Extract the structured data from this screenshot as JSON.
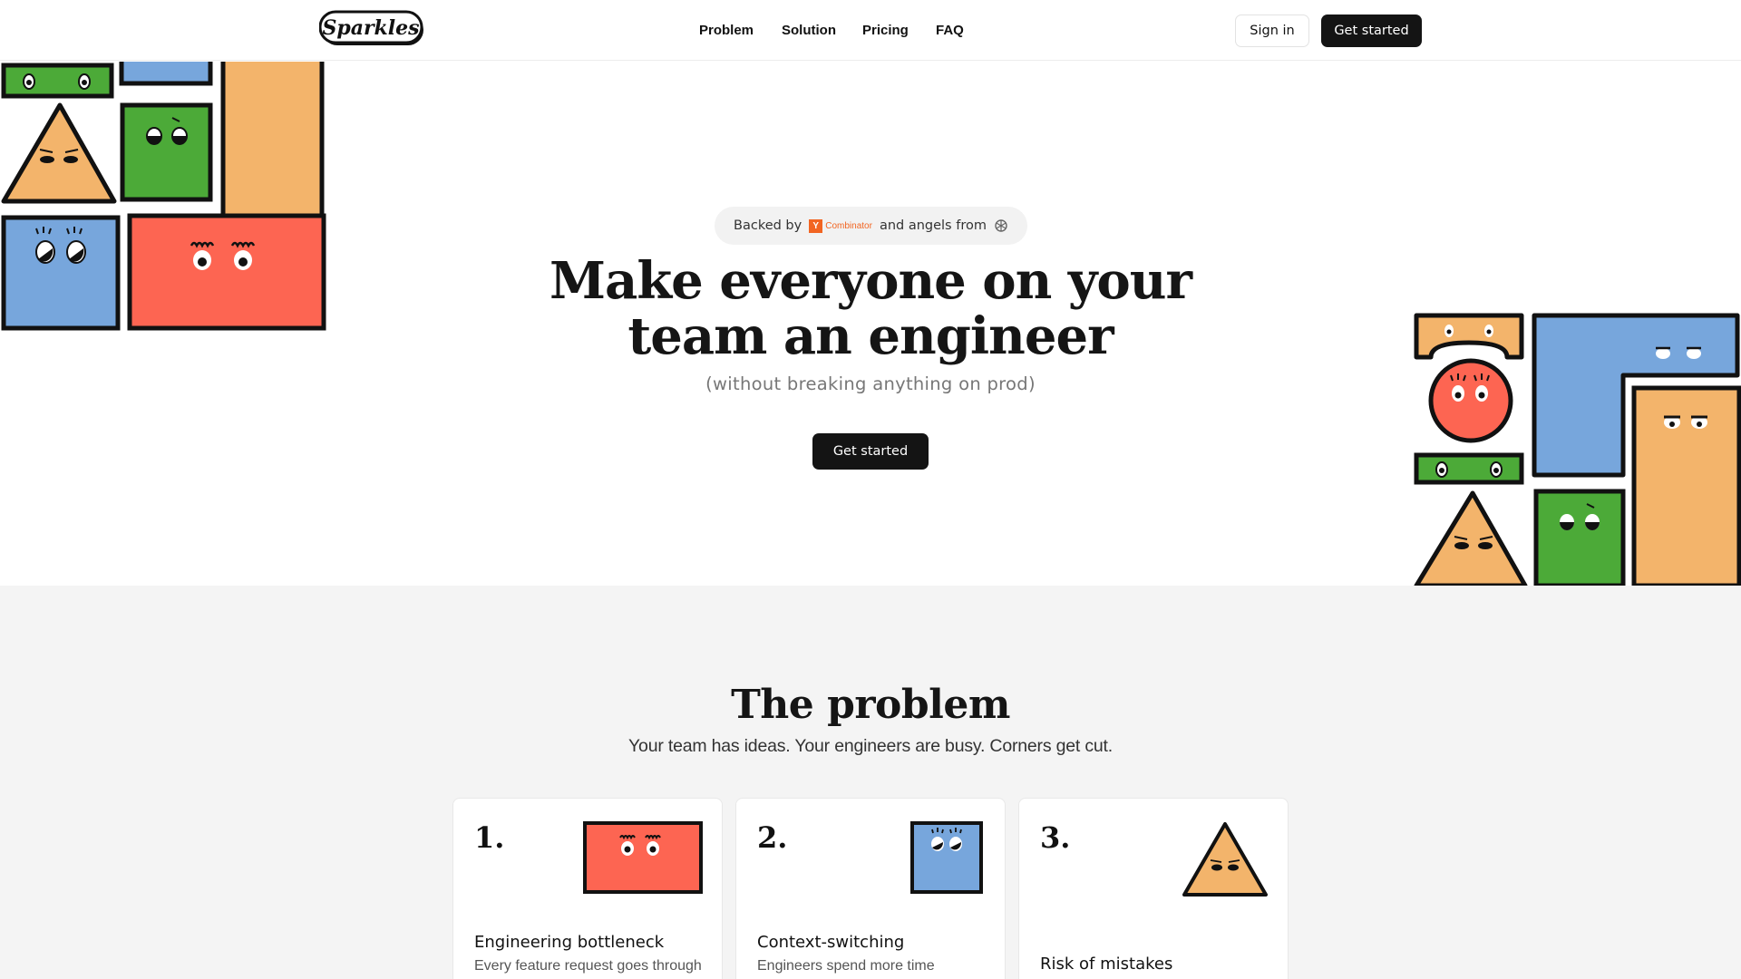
{
  "header": {
    "logo_text": "Sparkles",
    "nav": [
      "Problem",
      "Solution",
      "Pricing",
      "FAQ"
    ],
    "sign_in_label": "Sign in",
    "get_started_label": "Get started"
  },
  "hero": {
    "badge": {
      "prefix": "Backed by",
      "yc_letter": "Y",
      "yc_name": "Combinator",
      "middle": "and angels from",
      "icon": "openai-icon"
    },
    "headline_line1": "Make everyone on your",
    "headline_line2": "team an engineer",
    "subhead": "(without breaking anything on prod)",
    "cta_label": "Get started"
  },
  "problem": {
    "title": "The problem",
    "subtitle": "Your team has ideas. Your engineers are busy. Corners get cut.",
    "cards": [
      {
        "num": "1.",
        "title": "Engineering bottleneck",
        "desc": "Every feature request goes through"
      },
      {
        "num": "2.",
        "title": "Context-switching",
        "desc": "Engineers spend more time"
      },
      {
        "num": "3.",
        "title": "Risk of mistakes",
        "desc": ""
      }
    ]
  },
  "colors": {
    "green": "#4caa38",
    "blue": "#77a6dc",
    "orange": "#f3b46b",
    "red": "#fd6552",
    "dark": "#141414"
  }
}
